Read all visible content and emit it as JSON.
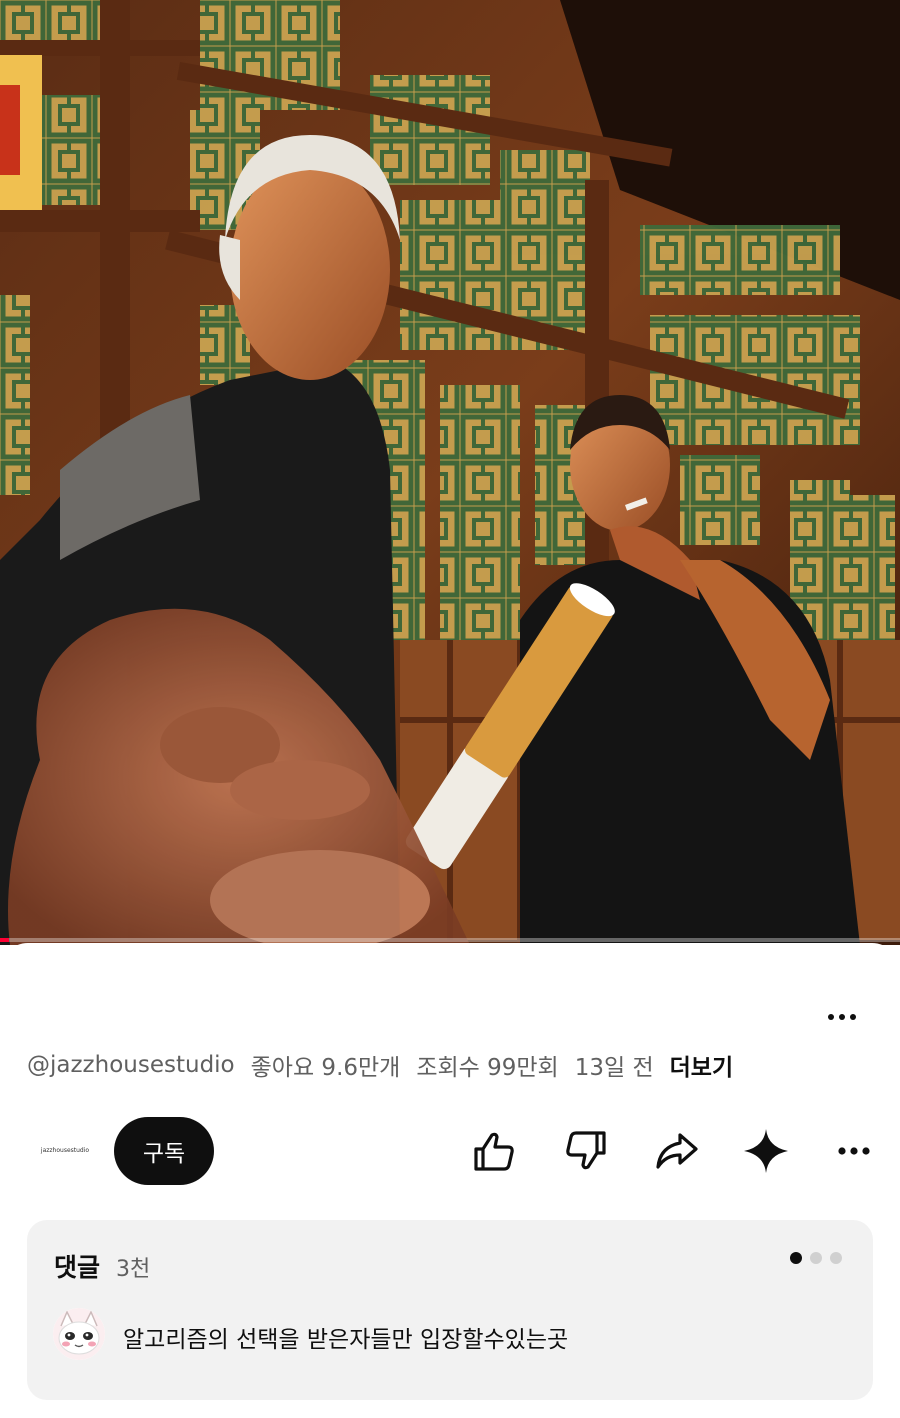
{
  "video": {
    "progress_fraction": 0.01
  },
  "meta": {
    "channel_handle": "@jazzhousestudio",
    "likes": "좋아요 9.6만개",
    "views": "조회수 99만회",
    "age": "13일 전",
    "more": "더보기"
  },
  "actions": {
    "channel_logo_text": "jazzhousestudio",
    "subscribe_label": "구독",
    "icons": [
      "like-icon",
      "dislike-icon",
      "share-icon",
      "remix-icon",
      "more-icon"
    ]
  },
  "comments": {
    "title": "댓글",
    "count": "3천",
    "top_comment": "알고리즘의 선택을 받은자들만 입장할수있는곳",
    "pages": 3,
    "active_page": 1
  },
  "colors": {
    "accent": "#ff0033",
    "subscribe_bg": "#0f0f0f",
    "card_bg": "#f2f2f2"
  }
}
